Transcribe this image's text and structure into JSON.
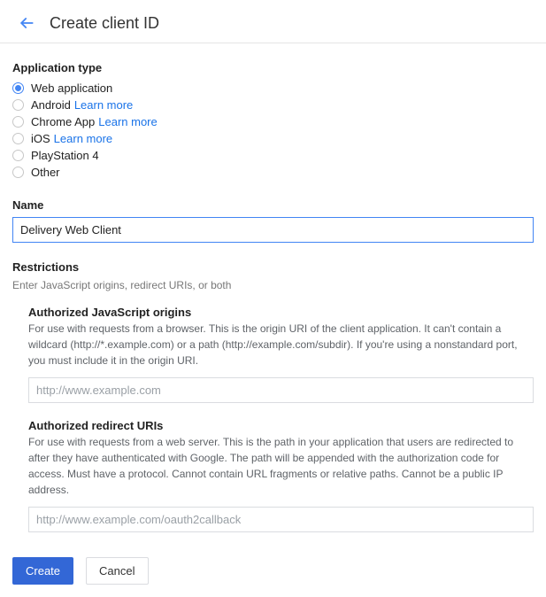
{
  "header": {
    "title": "Create client ID"
  },
  "appType": {
    "label": "Application type",
    "options": [
      {
        "label": "Web application",
        "selected": true
      },
      {
        "label": "Android",
        "learnMore": "Learn more"
      },
      {
        "label": "Chrome App",
        "learnMore": "Learn more"
      },
      {
        "label": "iOS",
        "learnMore": "Learn more"
      },
      {
        "label": "PlayStation 4"
      },
      {
        "label": "Other"
      }
    ]
  },
  "name": {
    "label": "Name",
    "value": "Delivery Web Client"
  },
  "restrictions": {
    "label": "Restrictions",
    "hint": "Enter JavaScript origins, redirect URIs, or both",
    "jsOrigins": {
      "title": "Authorized JavaScript origins",
      "desc": "For use with requests from a browser. This is the origin URI of the client application. It can't contain a wildcard (http://*.example.com) or a path (http://example.com/subdir). If you're using a nonstandard port, you must include it in the origin URI.",
      "placeholder": "http://www.example.com"
    },
    "redirects": {
      "title": "Authorized redirect URIs",
      "desc": "For use with requests from a web server. This is the path in your application that users are redirected to after they have authenticated with Google. The path will be appended with the authorization code for access. Must have a protocol. Cannot contain URL fragments or relative paths. Cannot be a public IP address.",
      "placeholder": "http://www.example.com/oauth2callback"
    }
  },
  "buttons": {
    "create": "Create",
    "cancel": "Cancel"
  }
}
